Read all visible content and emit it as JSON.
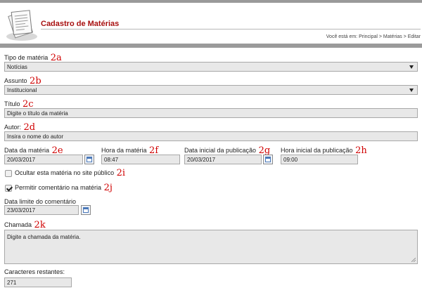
{
  "header": {
    "title": "Cadastro de Matérias",
    "breadcrumb": "Você está em: Principal > Matérias > Editar"
  },
  "fields": {
    "tipo": {
      "label": "Tipo de matéria",
      "annotation": "2a",
      "value": "Notícias"
    },
    "assunto": {
      "label": "Assunto",
      "annotation": "2b",
      "value": "Institucional"
    },
    "titulo": {
      "label": "Título",
      "annotation": "2c",
      "value": "Digite o título da matéria"
    },
    "autor": {
      "label": "Autor:",
      "annotation": "2d",
      "value": "Insira o nome do autor"
    },
    "data_materia": {
      "label": "Data da matéria",
      "annotation": "2e",
      "value": "20/03/2017"
    },
    "hora_materia": {
      "label": "Hora da matéria",
      "annotation": "2f",
      "value": "08:47"
    },
    "data_publicacao": {
      "label": "Data inicial da publicação",
      "annotation": "2g",
      "value": "20/03/2017"
    },
    "hora_publicacao": {
      "label": "Hora inicial da publicação",
      "annotation": "2h",
      "value": "09:00"
    },
    "ocultar": {
      "label": "Ocultar esta matéria no site público",
      "annotation": "2i",
      "checked": false
    },
    "permitir": {
      "label": "Permitir comentário na matéria",
      "annotation": "2j",
      "checked": true
    },
    "data_limite": {
      "label": "Data limite do comentário",
      "value": "23/03/2017"
    },
    "chamada": {
      "label": "Chamada",
      "annotation": "2k",
      "value": "Digite a chamada da matéria."
    },
    "caracteres": {
      "label": "Caracteres restantes:",
      "value": "271"
    }
  },
  "colors": {
    "title": "#a81010",
    "annotation": "#d00000",
    "rule": "#9a9a9a",
    "field_bg": "#e8e8e8"
  }
}
